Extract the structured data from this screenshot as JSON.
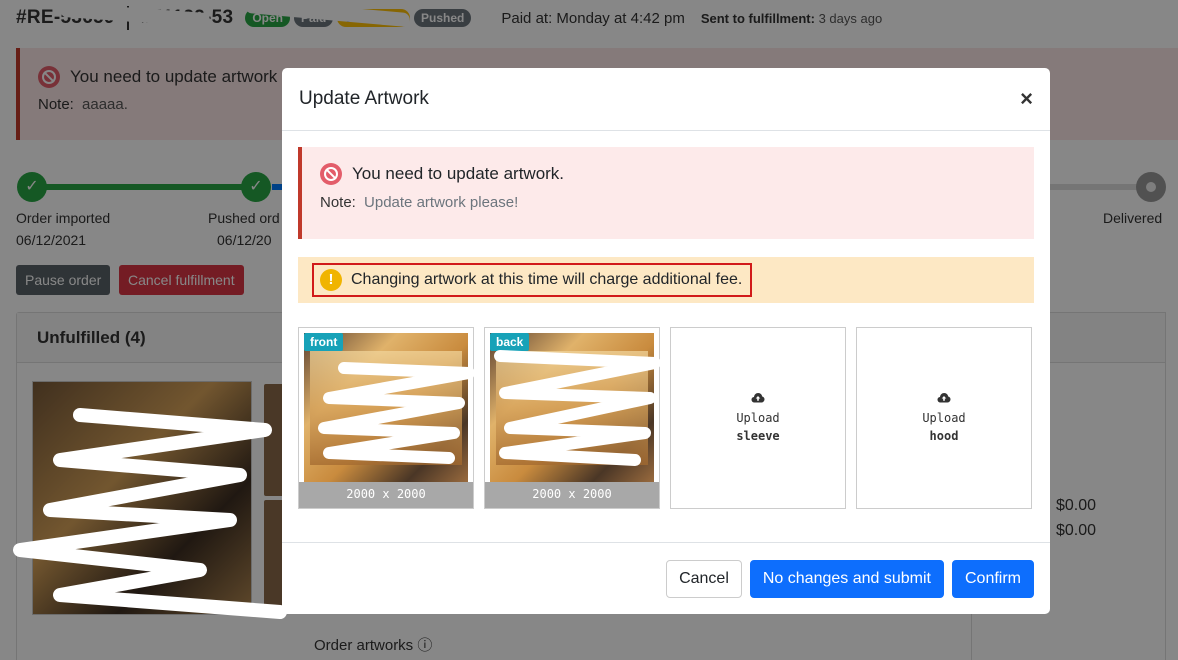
{
  "header": {
    "order_id_1": "#RE-53659",
    "order_id_2": "#51122-53",
    "badges": [
      "Open",
      "Paid",
      "Unfulfilled",
      "Pushed"
    ],
    "paid_at_label": "Paid at:",
    "paid_at_value": "Monday at 4:42 pm",
    "sent_label": "Sent to fulfillment:",
    "sent_value": "3 days ago"
  },
  "bg_alert": {
    "message": "You need to update artwork",
    "note_label": "Note:",
    "note_value": "aaaaa."
  },
  "timeline": {
    "steps": [
      {
        "label": "Order imported",
        "date": "06/12/2021"
      },
      {
        "label": "Pushed ord",
        "date": "06/12/20"
      },
      {
        "label": "Delivered",
        "date": ""
      }
    ]
  },
  "bg_buttons": {
    "pause": "Pause order",
    "cancel": "Cancel fulfillment"
  },
  "unfulfilled": {
    "title": "Unfulfilled (4)",
    "totals": [
      "$0.00",
      "$0.00"
    ],
    "order_artworks_label": "Order artworks ⓘ"
  },
  "modal": {
    "title": "Update Artwork",
    "close_label": "×",
    "danger_alert": {
      "message": "You need to update artwork.",
      "note_label": "Note:",
      "note_value": "Update artwork please!"
    },
    "warning": "Changing artwork at this time will charge additional fee.",
    "warning_icon": "!",
    "artworks": [
      {
        "tag": "front",
        "size": "2000 x 2000"
      },
      {
        "tag": "back",
        "size": "2000 x 2000"
      }
    ],
    "uploads": [
      {
        "label": "Upload",
        "target": "sleeve"
      },
      {
        "label": "Upload",
        "target": "hood"
      }
    ],
    "buttons": {
      "cancel": "Cancel",
      "no_changes": "No changes and submit",
      "confirm": "Confirm"
    }
  },
  "colors": {
    "primary": "#0d6efd",
    "danger_border": "#c0392b",
    "warning_bg": "#fde8c4",
    "success": "#28a745",
    "tag": "#17a2b8"
  }
}
